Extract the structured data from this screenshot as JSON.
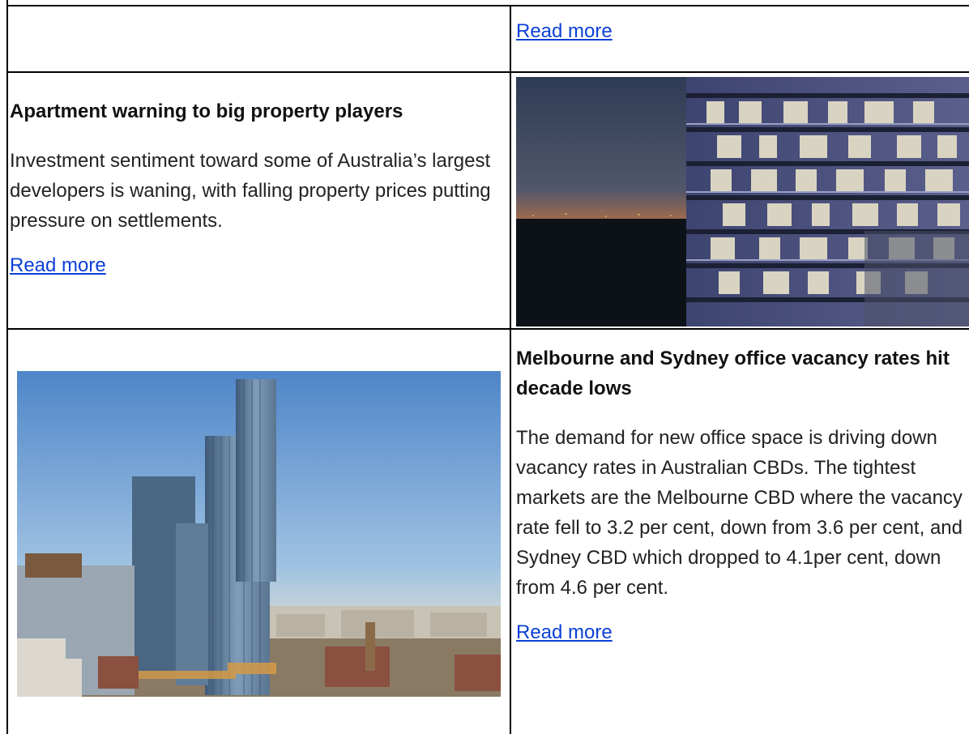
{
  "rows": [
    {
      "read_more": "Read more"
    },
    {
      "title": "Apartment warning to big property players",
      "body": "Investment sentiment toward some of Australia’s largest developers is waning, with falling property prices putting pressure on settlements.",
      "read_more": "Read more",
      "image_icon": "night-apartment-tower-image"
    },
    {
      "title": "Melbourne and Sydney office vacancy rates hit decade lows",
      "body": "The demand for new office space is driving down vacancy rates in Australian CBDs. The tightest markets are the Melbourne CBD where the vacancy rate fell to 3.2 per cent, down from 3.6 per cent, and Sydney CBD which dropped to 4.1per cent, down from 4.6 per cent.",
      "read_more": "Read more",
      "image_icon": "city-skyline-towers-image"
    }
  ],
  "colors": {
    "link": "#0b3fd6",
    "border": "#000000"
  }
}
